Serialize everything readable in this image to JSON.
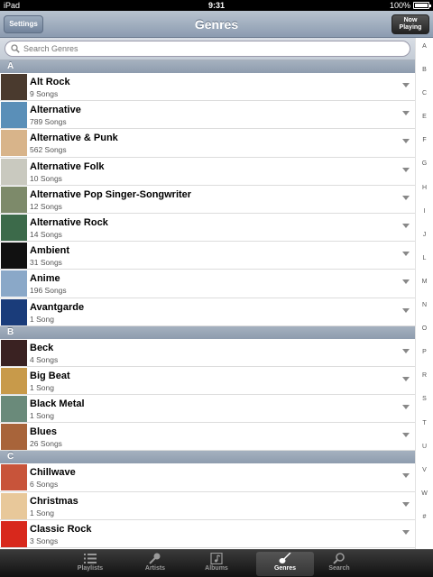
{
  "status": {
    "device": "iPad",
    "time": "9:31",
    "battery": "100%",
    "battery_level": 1.0
  },
  "nav": {
    "title": "Genres",
    "left_button": "Settings",
    "right_button_line1": "Now",
    "right_button_line2": "Playing"
  },
  "search": {
    "placeholder": "Search Genres"
  },
  "sections": [
    {
      "letter": "A",
      "items": [
        {
          "title": "Alt Rock",
          "count": "9 Songs"
        },
        {
          "title": "Alternative",
          "count": "789 Songs"
        },
        {
          "title": "Alternative & Punk",
          "count": "562 Songs"
        },
        {
          "title": "Alternative Folk",
          "count": "10 Songs"
        },
        {
          "title": "Alternative Pop Singer-Songwriter",
          "count": "12 Songs"
        },
        {
          "title": "Alternative Rock",
          "count": "14 Songs"
        },
        {
          "title": "Ambient",
          "count": "31 Songs"
        },
        {
          "title": "Anime",
          "count": "196 Songs"
        },
        {
          "title": "Avantgarde",
          "count": "1 Song"
        }
      ]
    },
    {
      "letter": "B",
      "items": [
        {
          "title": "Beck",
          "count": "4 Songs"
        },
        {
          "title": "Big Beat",
          "count": "1 Song"
        },
        {
          "title": "Black Metal",
          "count": "1 Song"
        },
        {
          "title": "Blues",
          "count": "26 Songs"
        }
      ]
    },
    {
      "letter": "C",
      "items": [
        {
          "title": "Chillwave",
          "count": "6 Songs"
        },
        {
          "title": "Christmas",
          "count": "1 Song"
        },
        {
          "title": "Classic Rock",
          "count": "3 Songs"
        }
      ]
    }
  ],
  "index_letters": [
    "A",
    "B",
    "C",
    "E",
    "F",
    "G",
    "H",
    "I",
    "J",
    "L",
    "M",
    "N",
    "O",
    "P",
    "R",
    "S",
    "T",
    "U",
    "V",
    "W",
    "#"
  ],
  "tabs": [
    {
      "label": "Playlists",
      "icon": "playlist-icon"
    },
    {
      "label": "Artists",
      "icon": "microphone-icon"
    },
    {
      "label": "Albums",
      "icon": "album-icon"
    },
    {
      "label": "Genres",
      "icon": "guitar-icon",
      "active": true
    },
    {
      "label": "Search",
      "icon": "search-icon"
    }
  ],
  "art_colors": [
    "#4a3a2e",
    "#5a8fb8",
    "#d8b48a",
    "#c9c9bf",
    "#7d8a6a",
    "#3c6a4a",
    "#111111",
    "#8aa8c8",
    "#1a3c7a",
    "#3a2222",
    "#c89a4a",
    "#6a8a7a",
    "#a8643a",
    "#c8543a",
    "#e8c89a",
    "#d8281c"
  ]
}
